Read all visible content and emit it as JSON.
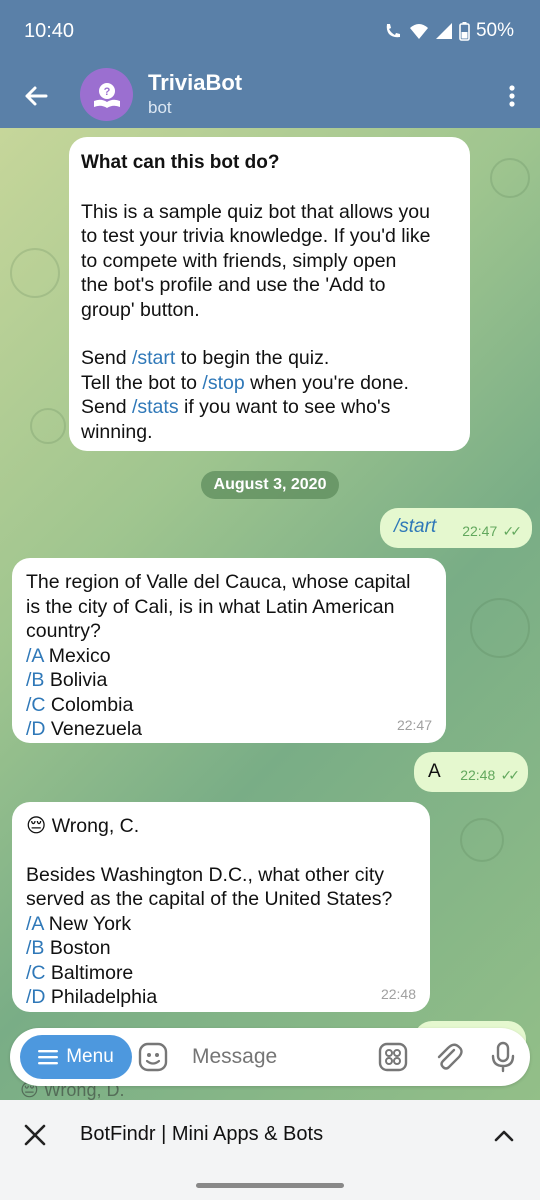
{
  "status": {
    "time": "10:40",
    "battery": "50%"
  },
  "header": {
    "title": "TriviaBot",
    "subtitle": "bot"
  },
  "intro": {
    "heading": "What can this bot do?",
    "para1_lines": [
      "This is a sample quiz bot that allows you",
      "to test your trivia knowledge. If you'd like",
      "to compete with friends, simply open",
      "the bot's profile and use the 'Add to",
      "group' button."
    ],
    "line_start": {
      "before": "Send ",
      "cmd": "/start",
      "after": " to begin the quiz."
    },
    "line_stop": {
      "before": "Tell the bot to ",
      "cmd": "/stop",
      "after": " when you're done."
    },
    "line_stats": {
      "before": "Send ",
      "cmd": "/stats",
      "after": " if you want to see who's"
    },
    "line_last": "winning."
  },
  "date_separator": "August 3, 2020",
  "out1": {
    "text": "/start",
    "time": "22:47"
  },
  "q1": {
    "lines": [
      "The region of Valle del Cauca, whose capital",
      "is the city of Cali, is in what Latin American",
      "country?"
    ],
    "options": [
      {
        "cmd": "/A",
        "text": " Mexico"
      },
      {
        "cmd": "/B",
        "text": " Bolivia"
      },
      {
        "cmd": "/C",
        "text": " Colombia"
      },
      {
        "cmd": "/D",
        "text": " Venezuela"
      }
    ],
    "time": "22:47"
  },
  "out2": {
    "text": "A",
    "time": "22:48"
  },
  "q2": {
    "feedback": "😔 Wrong, C.",
    "lines": [
      "Besides Washington D.C., what other city",
      "served as the capital of the United States?"
    ],
    "options": [
      {
        "cmd": "/A",
        "text": " New York"
      },
      {
        "cmd": "/B",
        "text": " Boston"
      },
      {
        "cmd": "/C",
        "text": " Baltimore"
      },
      {
        "cmd": "/D",
        "text": " Philadelphia"
      }
    ],
    "time": "22:48"
  },
  "peek_text": "😔 Wrong, D.",
  "composer": {
    "menu_label": "Menu",
    "placeholder": "Message"
  },
  "bottom": {
    "title": "BotFindr | Mini Apps & Bots"
  },
  "colors": {
    "header": "#5a80a8",
    "link": "#2f78b8",
    "outgoing": "#e5f8cf",
    "menu_button": "#4d98de"
  },
  "icons": [
    "back-arrow-icon",
    "avatar-bot-icon",
    "more-vert-icon",
    "sticker-icon",
    "bot-grid-icon",
    "attach-icon",
    "mic-icon",
    "close-icon",
    "chevron-up-icon"
  ]
}
